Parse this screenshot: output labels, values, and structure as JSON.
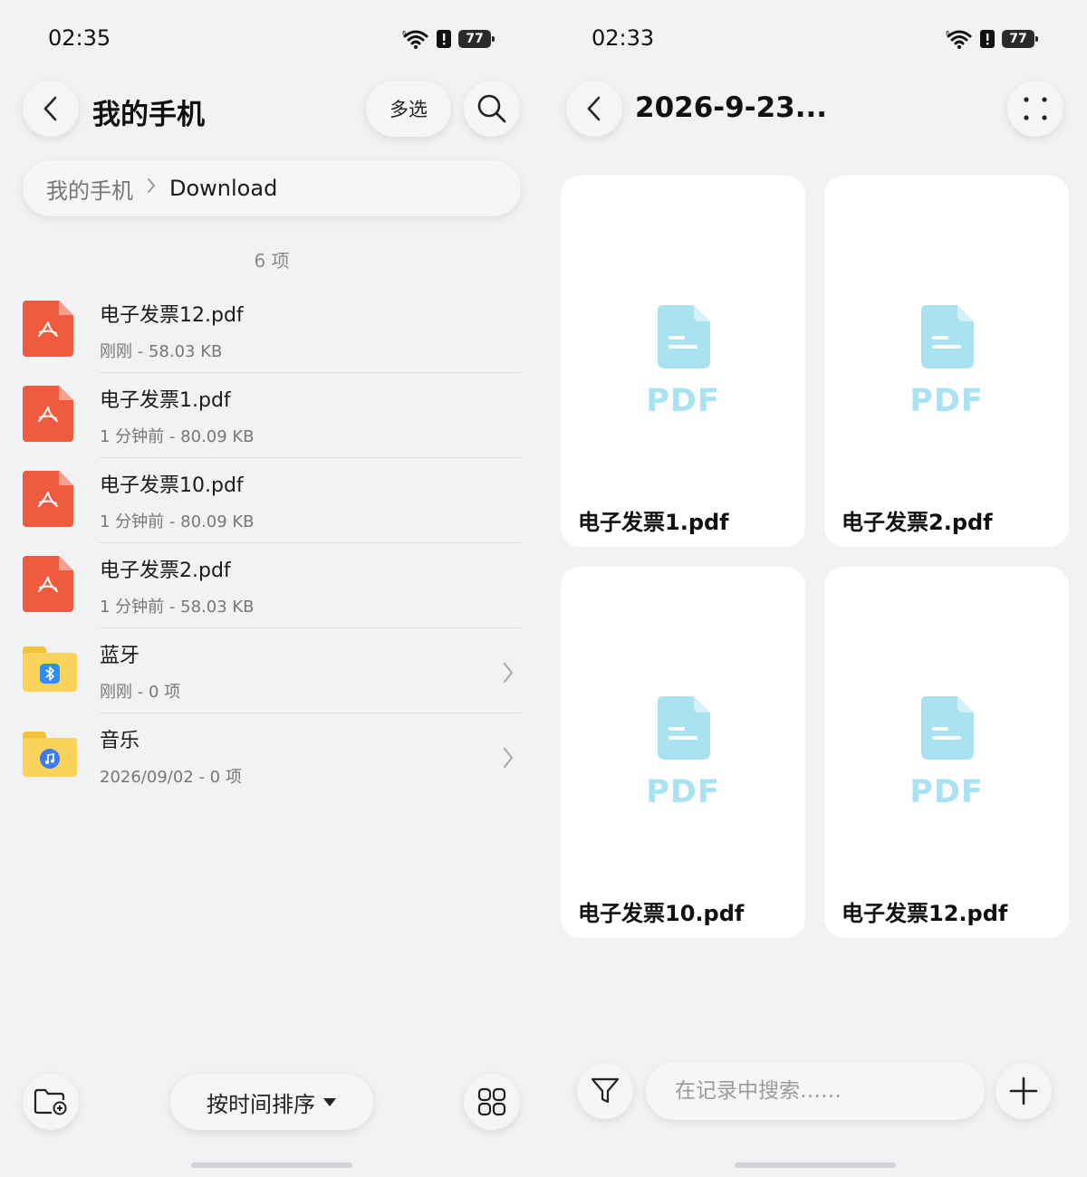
{
  "left": {
    "status": {
      "time": "02:35",
      "battery": "77"
    },
    "header": {
      "title": "我的手机",
      "multi_select_label": "多选"
    },
    "breadcrumb": {
      "root": "我的手机",
      "current": "Download"
    },
    "item_count": "6 项",
    "files": [
      {
        "name": "电子发票12.pdf",
        "meta": "刚刚 - 58.03 KB",
        "type": "pdf"
      },
      {
        "name": "电子发票1.pdf",
        "meta": "1 分钟前 - 80.09 KB",
        "type": "pdf"
      },
      {
        "name": "电子发票10.pdf",
        "meta": "1 分钟前 - 80.09 KB",
        "type": "pdf"
      },
      {
        "name": "电子发票2.pdf",
        "meta": "1 分钟前 - 58.03 KB",
        "type": "pdf"
      },
      {
        "name": "蓝牙",
        "meta": "刚刚 - 0 项",
        "type": "folder",
        "badge": "bluetooth-icon"
      },
      {
        "name": "音乐",
        "meta": "2026/09/02 - 0 项",
        "type": "folder",
        "badge": "music-icon"
      }
    ],
    "bottom": {
      "sort_label": "按时间排序"
    },
    "colors": {
      "pdf_red": "#f05a3e",
      "folder_yellow": "#fbd35a"
    }
  },
  "right": {
    "status": {
      "time": "02:33",
      "battery": "77"
    },
    "header": {
      "title": "2026-9-23..."
    },
    "cards": [
      {
        "label": "PDF",
        "name": "电子发票1.pdf"
      },
      {
        "label": "PDF",
        "name": "电子发票2.pdf"
      },
      {
        "label": "PDF",
        "name": "电子发票10.pdf"
      },
      {
        "label": "PDF",
        "name": "电子发票12.pdf"
      }
    ],
    "search": {
      "placeholder": "在记录中搜索……"
    },
    "colors": {
      "doc_icon": "#a9e3f2"
    }
  }
}
